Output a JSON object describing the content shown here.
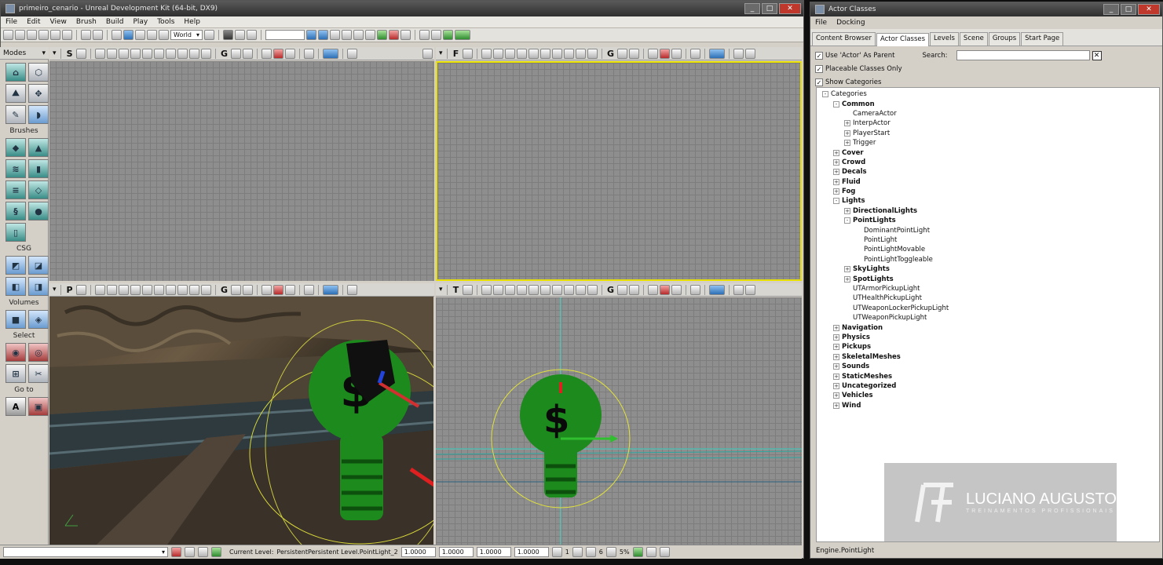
{
  "main_window": {
    "title": "primeiro_cenario - Unreal Development Kit (64-bit, DX9)",
    "window_buttons": [
      "_",
      "□",
      "✕"
    ],
    "menu": [
      "File",
      "Edit",
      "View",
      "Brush",
      "Build",
      "Play",
      "Tools",
      "Help"
    ],
    "toolbar": {
      "coord_system": "World"
    }
  },
  "modes_panel": {
    "title": "Modes",
    "sections": {
      "brushes": "Brushes",
      "csg": "CSG",
      "volumes": "Volumes",
      "select": "Select",
      "goto": "Go to"
    }
  },
  "viewports": {
    "top_left_letter": "S",
    "top_right_letter": "F",
    "bottom_left_letter": "P",
    "bottom_right_letter": "T",
    "g_label": "G"
  },
  "status_bar": {
    "current_level_label": "Current Level:",
    "current_level_value": "PersistentPersistent Level.PointLight_2",
    "values": [
      "1.0000",
      "1.0000",
      "1.0000",
      "1.0000"
    ],
    "grid": "1",
    "rotate": "6",
    "scale": "5%"
  },
  "actor_classes": {
    "title": "Actor Classes",
    "menu": [
      "File",
      "Docking"
    ],
    "tabs": [
      "Content Browser",
      "Actor Classes",
      "Levels",
      "Scene",
      "Groups",
      "Start Page"
    ],
    "active_tab": "Actor Classes",
    "options": {
      "use_actor_as_parent": "Use 'Actor' As Parent",
      "placeable_only": "Placeable Classes Only",
      "show_categories": "Show Categories"
    },
    "search_label": "Search:",
    "search_value": "",
    "tree": [
      {
        "label": "Categories",
        "level": 0,
        "expander": "-",
        "bold": false
      },
      {
        "label": "Common",
        "level": 1,
        "expander": "-",
        "bold": true
      },
      {
        "label": "CameraActor",
        "level": 2,
        "expander": "",
        "bold": false
      },
      {
        "label": "InterpActor",
        "level": 2,
        "expander": "+",
        "bold": false
      },
      {
        "label": "PlayerStart",
        "level": 2,
        "expander": "+",
        "bold": false
      },
      {
        "label": "Trigger",
        "level": 2,
        "expander": "+",
        "bold": false
      },
      {
        "label": "Cover",
        "level": 1,
        "expander": "+",
        "bold": true
      },
      {
        "label": "Crowd",
        "level": 1,
        "expander": "+",
        "bold": true
      },
      {
        "label": "Decals",
        "level": 1,
        "expander": "+",
        "bold": true
      },
      {
        "label": "Fluid",
        "level": 1,
        "expander": "+",
        "bold": true
      },
      {
        "label": "Fog",
        "level": 1,
        "expander": "+",
        "bold": true
      },
      {
        "label": "Lights",
        "level": 1,
        "expander": "-",
        "bold": true
      },
      {
        "label": "DirectionalLights",
        "level": 2,
        "expander": "+",
        "bold": true
      },
      {
        "label": "PointLights",
        "level": 2,
        "expander": "-",
        "bold": true
      },
      {
        "label": "DominantPointLight",
        "level": 3,
        "expander": "",
        "bold": false
      },
      {
        "label": "PointLight",
        "level": 3,
        "expander": "",
        "bold": false
      },
      {
        "label": "PointLightMovable",
        "level": 3,
        "expander": "",
        "bold": false
      },
      {
        "label": "PointLightToggleable",
        "level": 3,
        "expander": "",
        "bold": false
      },
      {
        "label": "SkyLights",
        "level": 2,
        "expander": "+",
        "bold": true
      },
      {
        "label": "SpotLights",
        "level": 2,
        "expander": "+",
        "bold": true
      },
      {
        "label": "UTArmorPickupLight",
        "level": 2,
        "expander": "",
        "bold": false
      },
      {
        "label": "UTHealthPickupLight",
        "level": 2,
        "expander": "",
        "bold": false
      },
      {
        "label": "UTWeaponLockerPickupLight",
        "level": 2,
        "expander": "",
        "bold": false
      },
      {
        "label": "UTWeaponPickupLight",
        "level": 2,
        "expander": "",
        "bold": false
      },
      {
        "label": "Navigation",
        "level": 1,
        "expander": "+",
        "bold": true
      },
      {
        "label": "Physics",
        "level": 1,
        "expander": "+",
        "bold": true
      },
      {
        "label": "Pickups",
        "level": 1,
        "expander": "+",
        "bold": true
      },
      {
        "label": "SkeletalMeshes",
        "level": 1,
        "expander": "+",
        "bold": true
      },
      {
        "label": "Sounds",
        "level": 1,
        "expander": "+",
        "bold": true
      },
      {
        "label": "StaticMeshes",
        "level": 1,
        "expander": "+",
        "bold": true
      },
      {
        "label": "Uncategorized",
        "level": 1,
        "expander": "+",
        "bold": true
      },
      {
        "label": "Vehicles",
        "level": 1,
        "expander": "+",
        "bold": true
      },
      {
        "label": "Wind",
        "level": 1,
        "expander": "+",
        "bold": true
      }
    ],
    "status": "Engine.PointLight"
  },
  "watermark": {
    "name": "LUCIANO AUGUSTO",
    "tagline": "TREINAMENTOS PROFISSIONAIS"
  }
}
